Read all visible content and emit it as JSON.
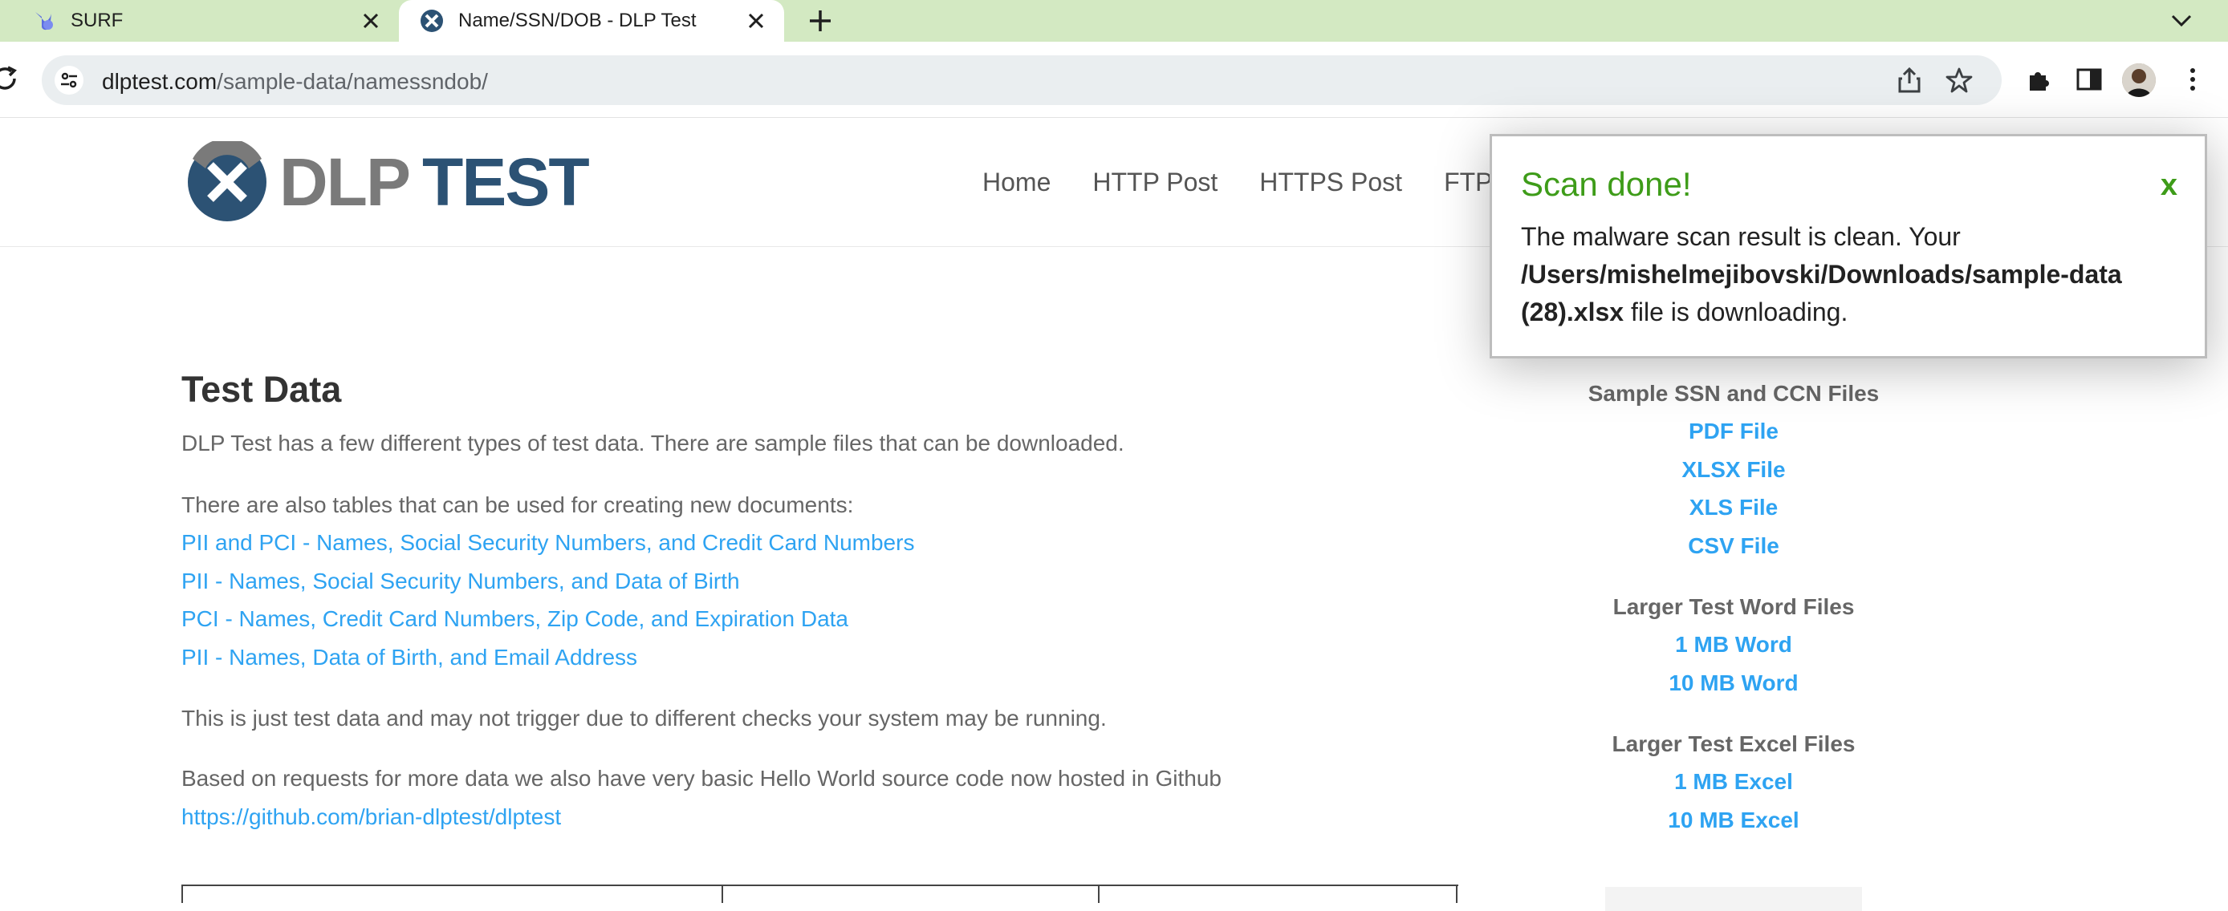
{
  "browser": {
    "tabs": [
      {
        "label": "SURF",
        "active": false,
        "icon": "surf-logo-icon"
      },
      {
        "label": "Name/SSN/DOB - DLP Test",
        "active": true,
        "icon": "dlptest-favicon-icon"
      }
    ],
    "url_domain": "dlptest.com",
    "url_path": "/sample-data/namessndob/"
  },
  "site": {
    "logo_dlp": "DLP",
    "logo_test": "TEST",
    "nav": [
      "Home",
      "HTTP Post",
      "HTTPS Post",
      "FTP"
    ]
  },
  "main": {
    "title": "Test Data",
    "intro": "DLP Test has a few different types of test data. There are sample files that can be downloaded.",
    "tables_intro": "There are also tables that can be used for creating new documents:",
    "links": [
      "PII and PCI - Names, Social Security Numbers, and Credit Card Numbers",
      "PII - Names, Social Security Numbers, and Data of Birth",
      "PCI - Names, Credit Card Numbers, Zip Code, and Expiration Data",
      "PII - Names, Data of Birth, and Email Address"
    ],
    "disclaimer": "This is just test data and may not trigger due to different checks your system may be running.",
    "github_intro": "Based on requests for more data we also have very basic Hello World source code now hosted in Github",
    "github_link": "https://github.com/brian-dlptest/dlptest"
  },
  "sidebar": {
    "sections": [
      {
        "heading": "Sample SSN and CCN Files",
        "links": [
          "PDF File",
          "XLSX File",
          "XLS File",
          "CSV File"
        ]
      },
      {
        "heading": "Larger Test Word Files",
        "links": [
          "1 MB Word",
          "10 MB Word"
        ]
      },
      {
        "heading": "Larger Test Excel Files",
        "links": [
          "1 MB Excel",
          "10 MB Excel"
        ]
      }
    ]
  },
  "popup": {
    "title": "Scan done!",
    "close": "x",
    "text_before": "The malware scan result is clean. Your",
    "file_path": "/Users/mishelmejibovski/Downloads/sample-data (28).xlsx",
    "text_after": "file is downloading."
  },
  "colors": {
    "tabstrip": "#d3e9c2",
    "link": "#2ea3f2",
    "popup_green": "#3e9c19",
    "logo_blue": "#2c5274"
  }
}
